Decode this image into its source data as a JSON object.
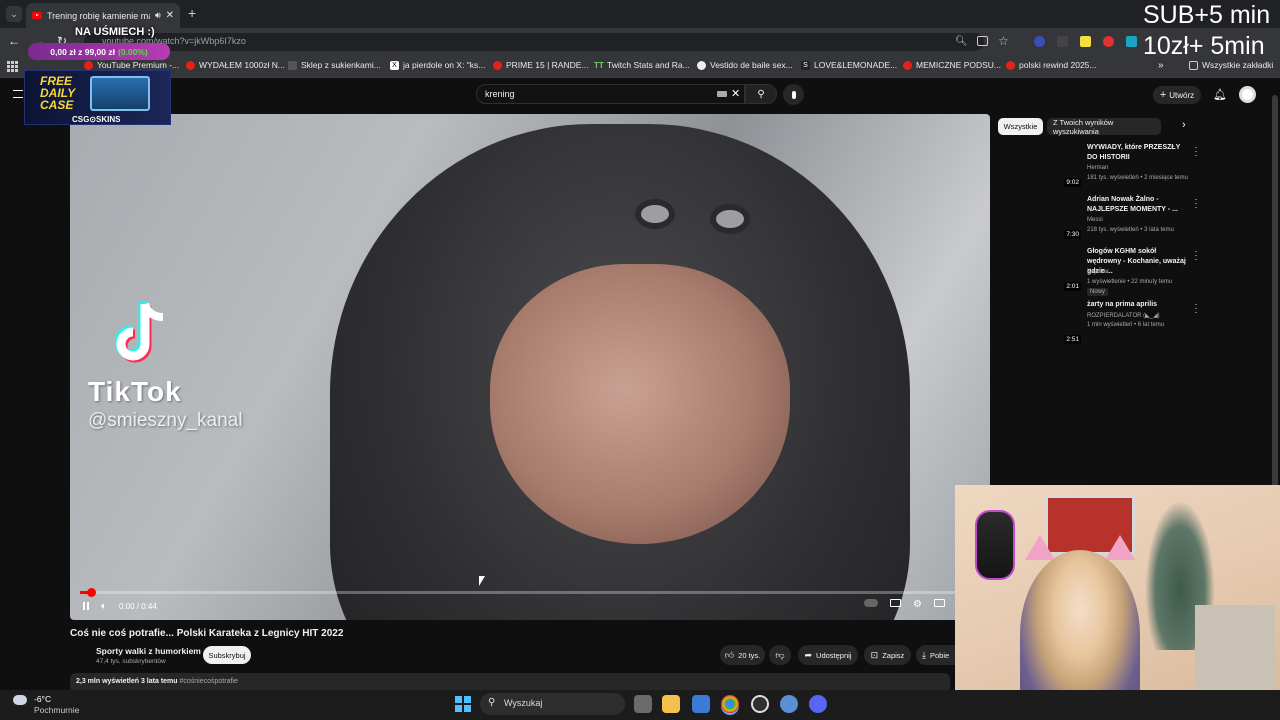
{
  "browser": {
    "tab_title": "Trening robię kamienie mar",
    "url": "youtube.com/watch?v=jkWbp6I7kzo",
    "bookmarks": [
      "YouTube Premium -...",
      "WYDAŁEM 1000zł N...",
      "Sklep z sukienkami...",
      "ja pierdole on X: \"ks...",
      "PRIME 15 | RANDE...",
      "Twitch Stats and Ra...",
      "Vestido de baile sex...",
      "LOVE&LEMONADE...",
      "MEMICZNE PODSU...",
      "polski rewind 2025..."
    ],
    "all_bookmarks": "Wszystkie zakładki"
  },
  "youtube": {
    "search_value": "krening",
    "create_label": "Utwórz",
    "player": {
      "time": "0:00 / 0:44",
      "progress_fraction": 0.01
    },
    "video_overlay": {
      "tiktok_label": "TikTok",
      "tiktok_handle": "@smieszny_kanal"
    },
    "title": "Coś nie coś potrafie... Polski Karateka z Legnicy HIT 2022",
    "channel": {
      "name": "Sporty walki z humorkiem",
      "subs": "47,4 tys. subskrybentów",
      "subscribe": "Subskrybuj"
    },
    "actions": {
      "likes": "20 tys.",
      "share": "Udostępnij",
      "save": "Zapisz",
      "download": "Pobie"
    },
    "description_meta": "2,3 mln wyświetleń  3 lata temu",
    "hashtag": "#cośniecośpotrafie",
    "chips": [
      "Wszystkie",
      "Z Twoich wyników wyszukiwania"
    ],
    "recommendations": [
      {
        "title": "WYWIADY, które PRZESZŁY DO HISTORII",
        "channel": "Herman",
        "meta": "181 tys. wyświetleń • 2 miesiące temu",
        "duration": "9:02",
        "badge": ""
      },
      {
        "title": "Adrian Nowak Żalno - NAJLEPSZE MOMENTY - ...",
        "channel": "Messi",
        "meta": "218 tys. wyświetleń • 3 lata temu",
        "duration": "7:30",
        "badge": ""
      },
      {
        "title": "Głogów KGHM sokół wędrowny - Kochanie, uważaj gdzie ...",
        "channel": "Kajotkar",
        "meta": "1 wyświetlenie • 22 minuty temu",
        "duration": "2:01",
        "badge": "Nowy"
      },
      {
        "title": "żarty na prima aprilis",
        "channel": "ROZPIERDALATOR (◣_◢)",
        "meta": "1 mln wyświetleń • 6 lat temu",
        "duration": "2:51",
        "badge": ""
      }
    ]
  },
  "stream_overlay": {
    "sub_line1": "SUB+5 min",
    "sub_line2": "10zł+ 5min",
    "goal_title": "NA UŚMIECH :)",
    "goal_amount": "0,00 zł z 99,00 zł",
    "goal_pct": "(0.00%)",
    "ad_text": "FREE DAILY CASE",
    "ad_brand": "CSG⊙SKINS"
  },
  "taskbar": {
    "temp": "-6°C",
    "weather": "Pochmurnie",
    "search": "Wyszukaj"
  },
  "colors": {
    "yt_red": "#ff0000",
    "bg": "#0f0f0f",
    "goal_green": "#55e03c"
  }
}
